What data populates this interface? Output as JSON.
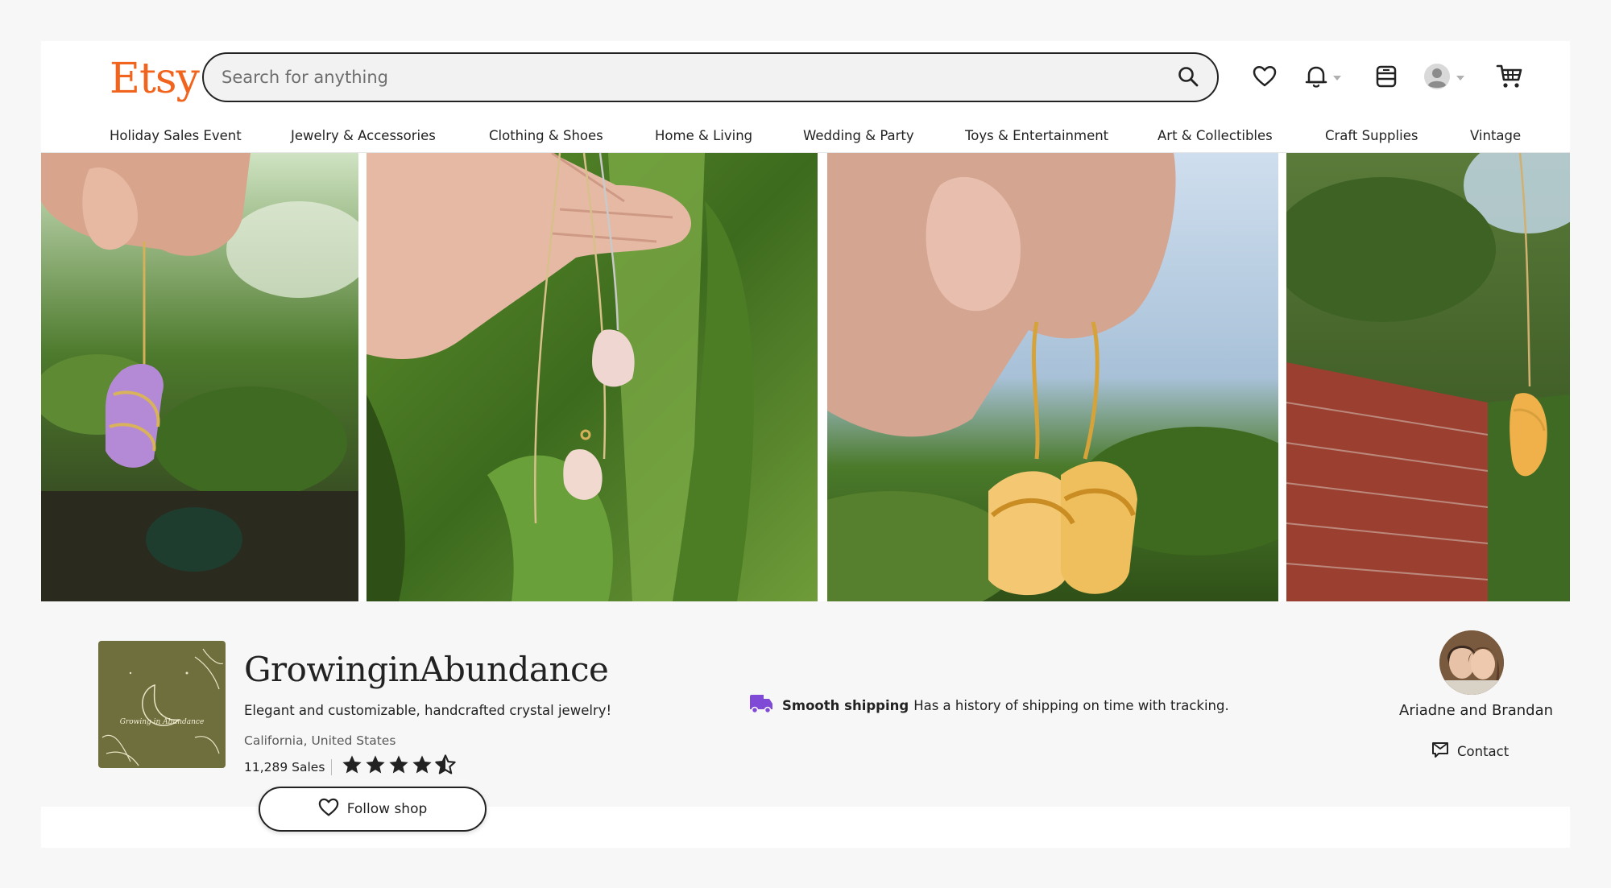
{
  "header": {
    "logo": "Etsy",
    "search_placeholder": "Search for anything",
    "icons": [
      "search-icon",
      "heart-icon",
      "bell-icon",
      "shop-manager-icon",
      "user-icon",
      "cart-icon"
    ]
  },
  "nav": {
    "items": [
      "Holiday Sales Event",
      "Jewelry & Accessories",
      "Clothing & Shoes",
      "Home & Living",
      "Wedding & Party",
      "Toys & Entertainment",
      "Art & Collectibles",
      "Craft Supplies",
      "Vintage"
    ]
  },
  "shop": {
    "logo_text": "Growing in Abundance",
    "name": "GrowinginAbundance",
    "tagline": "Elegant and customizable, handcrafted crystal jewelry!",
    "location": "California, United States",
    "sales": "11,289 Sales",
    "rating": 4.5,
    "follow_label": "Follow shop"
  },
  "shipping": {
    "title": "Smooth shipping",
    "text": "Has a history of shipping on time with tracking."
  },
  "owner": {
    "name": "Ariadne and Brandan",
    "contact_label": "Contact"
  },
  "colors": {
    "brand": "#f1641e",
    "shipping_icon": "#7f4bd6",
    "shop_logo_bg": "#6e6f3c"
  }
}
